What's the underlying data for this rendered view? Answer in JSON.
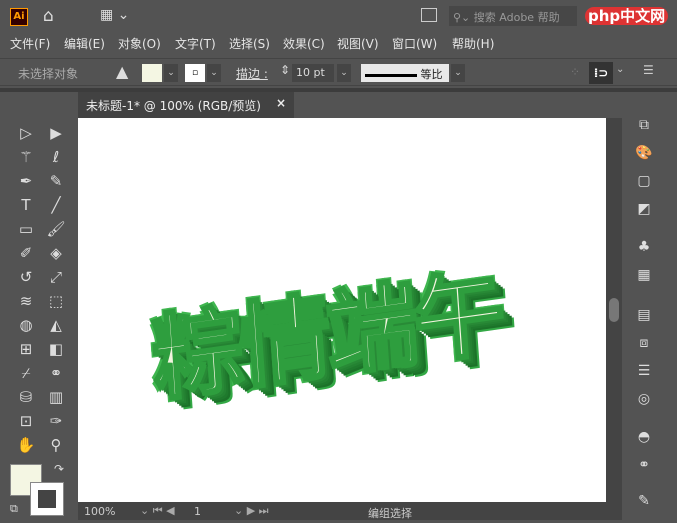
{
  "app": {
    "logo": "Ai",
    "search_placeholder": "搜索 Adobe 帮助",
    "watermark": "php中文网"
  },
  "menu": [
    "文件(F)",
    "编辑(E)",
    "对象(O)",
    "文字(T)",
    "选择(S)",
    "效果(C)",
    "视图(V)",
    "窗口(W)",
    "帮助(H)"
  ],
  "control": {
    "selection": "未选择对象",
    "stroke_label": "描边 :",
    "stroke_value": "10 pt",
    "profile": "等比",
    "fill_color": "#f4f6e3"
  },
  "document": {
    "tab_title": "未标题-1* @ 100% (RGB/预览)",
    "close": "×"
  },
  "artwork": {
    "text": "粽情端午",
    "fill": "#f2f4df",
    "stroke": "#2e9e3e"
  },
  "status": {
    "zoom": "100%",
    "artboard": "1",
    "tool": "编组选择"
  }
}
